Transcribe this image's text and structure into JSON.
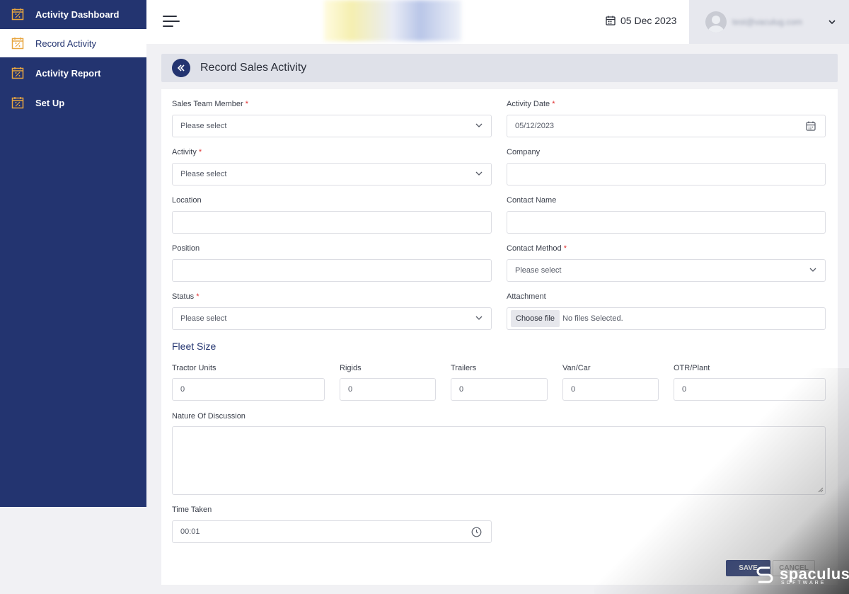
{
  "sidebar": {
    "items": [
      {
        "label": "Activity Dashboard",
        "icon": "calendar-percent-icon"
      },
      {
        "label": "Record Activity",
        "icon": "calendar-percent-icon",
        "active": true
      },
      {
        "label": "Activity Report",
        "icon": "calendar-percent-icon"
      },
      {
        "label": "Set Up",
        "icon": "calendar-percent-icon"
      }
    ]
  },
  "header": {
    "date": "05 Dec 2023",
    "user_email": "test@vaculug.com"
  },
  "page": {
    "title": "Record Sales Activity"
  },
  "form": {
    "sales_team_member": {
      "label": "Sales Team Member",
      "req": "*",
      "placeholder": "Please select"
    },
    "activity_date": {
      "label": "Activity Date",
      "req": "*",
      "value": "05/12/2023"
    },
    "activity": {
      "label": "Activity",
      "req": "*",
      "placeholder": "Please select"
    },
    "company": {
      "label": "Company",
      "value": ""
    },
    "location": {
      "label": "Location",
      "value": ""
    },
    "contact_name": {
      "label": "Contact Name",
      "value": ""
    },
    "position": {
      "label": "Position",
      "value": ""
    },
    "contact_method": {
      "label": "Contact Method",
      "req": "*",
      "placeholder": "Please select"
    },
    "status": {
      "label": "Status",
      "req": "*",
      "placeholder": "Please select"
    },
    "attachment": {
      "label": "Attachment",
      "button": "Choose file",
      "status": "No files Selected."
    },
    "fleet_size": {
      "title": "Fleet Size",
      "fields": [
        {
          "label": "Tractor Units",
          "value": "0"
        },
        {
          "label": "Rigids",
          "value": "0"
        },
        {
          "label": "Trailers",
          "value": "0"
        },
        {
          "label": "Van/Car",
          "value": "0"
        },
        {
          "label": "OTR/Plant",
          "value": "0"
        }
      ]
    },
    "nature_of_discussion": {
      "label": "Nature Of Discussion",
      "value": ""
    },
    "time_taken": {
      "label": "Time Taken",
      "value": "00:01"
    },
    "save_label": "SAVE",
    "cancel_label": "CANCEL"
  },
  "brand": {
    "name": "spaculus",
    "sub": "SOFTWARE"
  },
  "colors": {
    "primary": "#233470",
    "required": "#e03131",
    "accent_icon": "#e8a640"
  }
}
